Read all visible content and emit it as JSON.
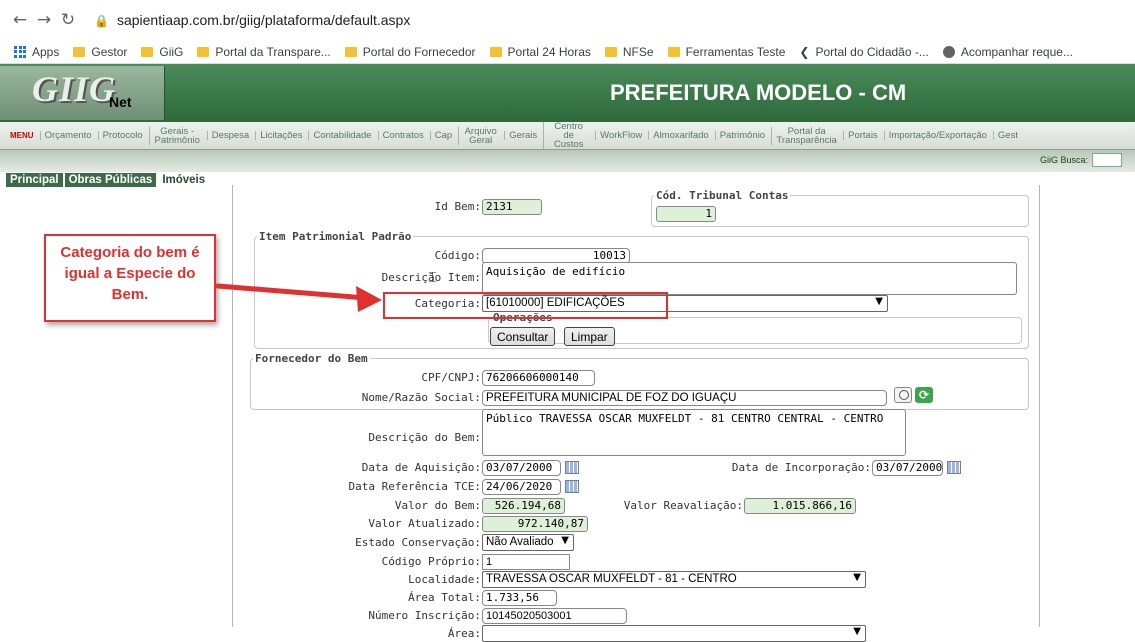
{
  "browser": {
    "url": "sapientiaap.com.br/giig/plataforma/default.aspx",
    "bookmarks": [
      "Apps",
      "Gestor",
      "GiiG",
      "Portal da Transpare...",
      "Portal do Fornecedor",
      "Portal 24 Horas",
      "NFSe",
      "Ferramentas Teste",
      "Portal do Cidadão -...",
      "Acompanhar reque..."
    ]
  },
  "header": {
    "logo": "GIIG",
    "logo_sub": "Net",
    "title": "PREFEITURA MODELO - CM"
  },
  "menu": [
    "MENU",
    "Orçamento",
    "Protocolo",
    "Gerais - Patrimônio",
    "Despesa",
    "Licitações",
    "Contabilidade",
    "Contratos",
    "Cap",
    "Arquivo Geral",
    "Gerais",
    "Centro de Custos",
    "WorkFlow",
    "Almoxarifado",
    "Patrimônio",
    "Portal da Transparência",
    "Portais",
    "Importação/Exportação",
    "Gest"
  ],
  "busca_label": "GiiG Busca:",
  "tabs": [
    "Principal",
    "Obras Públicas",
    "Imóveis"
  ],
  "annotation": {
    "text": "Categoria do bem é igual a Especie do Bem.",
    "color": "#e03030"
  },
  "form": {
    "id_bem": {
      "label": "Id Bem:",
      "value": "2131"
    },
    "cod_tribunal": {
      "legend": "Cód. Tribunal Contas",
      "value": "1"
    },
    "item_patrimonial": {
      "legend": "Item Patrimonial Padrão",
      "codigo": {
        "label": "Código:",
        "value": "10013"
      },
      "descricao": {
        "label": "Descrição Item:",
        "value": "Aquisição de edifício"
      },
      "categoria": {
        "label": "Categoria:",
        "value": "[61010000] EDIFICAÇÕES"
      },
      "operacoes": {
        "legend": "Operações",
        "consultar": "Consultar",
        "limpar": "Limpar"
      }
    },
    "fornecedor": {
      "legend": "Fornecedor do Bem",
      "cpf": {
        "label": "CPF/CNPJ:",
        "value": "76206606000140"
      },
      "nome": {
        "label": "Nome/Razão Social:",
        "value": "PREFEITURA MUNICIPAL DE FOZ DO IGUAÇU"
      }
    },
    "descricao_bem": {
      "label": "Descrição do Bem:",
      "value": "Público TRAVESSA OSCAR MUXFELDT - 81 CENTRO CENTRAL - CENTRO"
    },
    "data_aquisicao": {
      "label": "Data de Aquisição:",
      "value": "03/07/2000"
    },
    "data_incorporacao": {
      "label": "Data de Incorporação:",
      "value": "03/07/2000"
    },
    "data_tce": {
      "label": "Data Referência TCE:",
      "value": "24/06/2020"
    },
    "valor_bem": {
      "label": "Valor do Bem:",
      "value": "526.194,68"
    },
    "valor_reavaliacao": {
      "label": "Valor Reavaliação:",
      "value": "1.015.866,16"
    },
    "valor_atualizado": {
      "label": "Valor Atualizado:",
      "value": "972.140,87"
    },
    "estado": {
      "label": "Estado Conservação:",
      "value": "Não Avaliado"
    },
    "codigo_proprio": {
      "label": "Código Próprio:",
      "value": "1"
    },
    "localidade": {
      "label": "Localidade:",
      "value": "TRAVESSA OSCAR MUXFELDT - 81 - CENTRO"
    },
    "area_total": {
      "label": "Área Total:",
      "value": "1.733,56"
    },
    "numero_inscricao": {
      "label": "Número Inscrição:",
      "value": "10145020503001"
    },
    "area": {
      "label": "Área:",
      "value": ""
    }
  }
}
